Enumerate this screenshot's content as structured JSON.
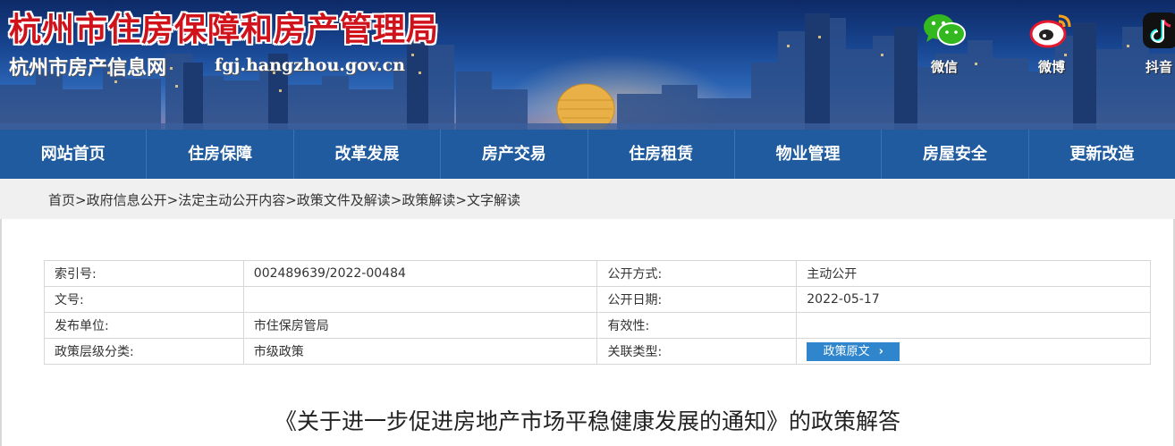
{
  "header": {
    "title": "杭州市住房保障和房产管理局",
    "subtitle": "杭州市房产信息网",
    "domain": "fgj.hangzhou.gov.cn",
    "social": [
      {
        "label": "微信",
        "icon": "wechat-icon"
      },
      {
        "label": "微博",
        "icon": "weibo-icon"
      },
      {
        "label": "抖音",
        "icon": "douyin-icon"
      }
    ]
  },
  "nav": {
    "items": [
      {
        "label": "网站首页"
      },
      {
        "label": "住房保障"
      },
      {
        "label": "改革发展"
      },
      {
        "label": "房产交易"
      },
      {
        "label": "住房租赁"
      },
      {
        "label": "物业管理"
      },
      {
        "label": "房屋安全"
      },
      {
        "label": "更新改造"
      }
    ]
  },
  "breadcrumb": {
    "items": [
      "首页",
      "政府信息公开",
      "法定主动公开内容",
      "政策文件及解读",
      "政策解读",
      "文字解读"
    ],
    "separator": ">"
  },
  "info": {
    "rows": [
      {
        "k1": "索引号:",
        "v1": "002489639/2022-00484",
        "k2": "公开方式:",
        "v2": "主动公开"
      },
      {
        "k1": "文号:",
        "v1": "",
        "k2": "公开日期:",
        "v2": "2022-05-17"
      },
      {
        "k1": "发布单位:",
        "v1": "市住保房管局",
        "k2": "有效性:",
        "v2": ""
      },
      {
        "k1": "政策层级分类:",
        "v1": "市级政策",
        "k2": "关联类型:",
        "v2": ""
      }
    ],
    "policy_button": "政策原文",
    "policy_button_chevron": "›"
  },
  "article": {
    "title": "《关于进一步促进房地产市场平稳健康发展的通知》的政策解答"
  },
  "colors": {
    "nav_bg": "#1f5b9e",
    "title_red": "#d0121b",
    "button_blue": "#2f86cc",
    "breadcrumb_bg": "#f0f0f0"
  }
}
